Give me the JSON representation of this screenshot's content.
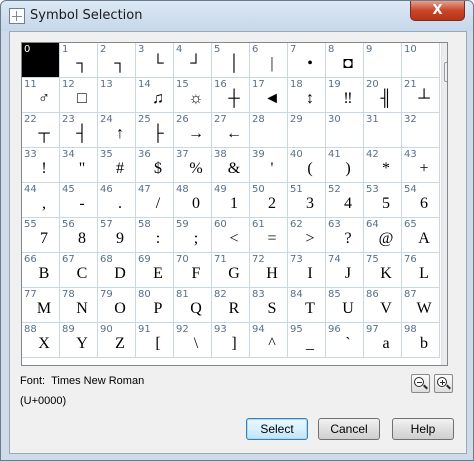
{
  "window": {
    "title": "Symbol Selection",
    "close_label": "X"
  },
  "grid": {
    "selected_index": 0,
    "cells": [
      {
        "num": "0",
        "glyph": ""
      },
      {
        "num": "1",
        "glyph": "┐"
      },
      {
        "num": "2",
        "glyph": "┐"
      },
      {
        "num": "3",
        "glyph": "└"
      },
      {
        "num": "4",
        "glyph": "┘"
      },
      {
        "num": "5",
        "glyph": "│"
      },
      {
        "num": "6",
        "glyph": "|"
      },
      {
        "num": "7",
        "glyph": "•"
      },
      {
        "num": "8",
        "glyph": "◘"
      },
      {
        "num": "9",
        "glyph": ""
      },
      {
        "num": "10",
        "glyph": ""
      },
      {
        "num": "11",
        "glyph": "♂"
      },
      {
        "num": "12",
        "glyph": "□"
      },
      {
        "num": "13",
        "glyph": ""
      },
      {
        "num": "14",
        "glyph": "♫"
      },
      {
        "num": "15",
        "glyph": "☼"
      },
      {
        "num": "16",
        "glyph": "┼"
      },
      {
        "num": "17",
        "glyph": "◄"
      },
      {
        "num": "18",
        "glyph": "↕"
      },
      {
        "num": "19",
        "glyph": "‼"
      },
      {
        "num": "20",
        "glyph": "╢"
      },
      {
        "num": "21",
        "glyph": "┴"
      },
      {
        "num": "22",
        "glyph": "┬"
      },
      {
        "num": "23",
        "glyph": "┤"
      },
      {
        "num": "24",
        "glyph": "↑"
      },
      {
        "num": "25",
        "glyph": "├"
      },
      {
        "num": "26",
        "glyph": "→"
      },
      {
        "num": "27",
        "glyph": "←"
      },
      {
        "num": "28",
        "glyph": ""
      },
      {
        "num": "29",
        "glyph": ""
      },
      {
        "num": "30",
        "glyph": ""
      },
      {
        "num": "31",
        "glyph": ""
      },
      {
        "num": "32",
        "glyph": ""
      },
      {
        "num": "33",
        "glyph": "!"
      },
      {
        "num": "34",
        "glyph": "\""
      },
      {
        "num": "35",
        "glyph": "#"
      },
      {
        "num": "36",
        "glyph": "$"
      },
      {
        "num": "37",
        "glyph": "%"
      },
      {
        "num": "38",
        "glyph": "&"
      },
      {
        "num": "39",
        "glyph": "'"
      },
      {
        "num": "40",
        "glyph": "("
      },
      {
        "num": "41",
        "glyph": ")"
      },
      {
        "num": "42",
        "glyph": "*"
      },
      {
        "num": "43",
        "glyph": "+"
      },
      {
        "num": "44",
        "glyph": ","
      },
      {
        "num": "45",
        "glyph": "-"
      },
      {
        "num": "46",
        "glyph": "."
      },
      {
        "num": "47",
        "glyph": "/"
      },
      {
        "num": "48",
        "glyph": "0"
      },
      {
        "num": "49",
        "glyph": "1"
      },
      {
        "num": "50",
        "glyph": "2"
      },
      {
        "num": "51",
        "glyph": "3"
      },
      {
        "num": "52",
        "glyph": "4"
      },
      {
        "num": "53",
        "glyph": "5"
      },
      {
        "num": "54",
        "glyph": "6"
      },
      {
        "num": "55",
        "glyph": "7"
      },
      {
        "num": "56",
        "glyph": "8"
      },
      {
        "num": "57",
        "glyph": "9"
      },
      {
        "num": "58",
        "glyph": ":"
      },
      {
        "num": "59",
        "glyph": ";"
      },
      {
        "num": "60",
        "glyph": "<"
      },
      {
        "num": "61",
        "glyph": "="
      },
      {
        "num": "62",
        "glyph": ">"
      },
      {
        "num": "63",
        "glyph": "?"
      },
      {
        "num": "64",
        "glyph": "@"
      },
      {
        "num": "65",
        "glyph": "A"
      },
      {
        "num": "66",
        "glyph": "B"
      },
      {
        "num": "67",
        "glyph": "C"
      },
      {
        "num": "68",
        "glyph": "D"
      },
      {
        "num": "69",
        "glyph": "E"
      },
      {
        "num": "70",
        "glyph": "F"
      },
      {
        "num": "71",
        "glyph": "G"
      },
      {
        "num": "72",
        "glyph": "H"
      },
      {
        "num": "73",
        "glyph": "I"
      },
      {
        "num": "74",
        "glyph": "J"
      },
      {
        "num": "75",
        "glyph": "K"
      },
      {
        "num": "76",
        "glyph": "L"
      },
      {
        "num": "77",
        "glyph": "M"
      },
      {
        "num": "78",
        "glyph": "N"
      },
      {
        "num": "79",
        "glyph": "O"
      },
      {
        "num": "80",
        "glyph": "P"
      },
      {
        "num": "81",
        "glyph": "Q"
      },
      {
        "num": "82",
        "glyph": "R"
      },
      {
        "num": "83",
        "glyph": "S"
      },
      {
        "num": "84",
        "glyph": "T"
      },
      {
        "num": "85",
        "glyph": "U"
      },
      {
        "num": "86",
        "glyph": "V"
      },
      {
        "num": "87",
        "glyph": "W"
      },
      {
        "num": "88",
        "glyph": "X"
      },
      {
        "num": "89",
        "glyph": "Y"
      },
      {
        "num": "90",
        "glyph": "Z"
      },
      {
        "num": "91",
        "glyph": "["
      },
      {
        "num": "92",
        "glyph": "\\"
      },
      {
        "num": "93",
        "glyph": "]"
      },
      {
        "num": "94",
        "glyph": "^"
      },
      {
        "num": "95",
        "glyph": "_"
      },
      {
        "num": "96",
        "glyph": "`"
      },
      {
        "num": "97",
        "glyph": "a"
      },
      {
        "num": "98",
        "glyph": "b"
      }
    ]
  },
  "scroll": {
    "up_icon": "▲",
    "down_icon": "▼"
  },
  "font_info": {
    "label": "Font:",
    "value": "Times New Roman"
  },
  "code_info": {
    "value": "(U+0000)"
  },
  "zoom": {
    "out_icon": "zoom-out-icon",
    "in_icon": "zoom-in-icon"
  },
  "buttons": {
    "select": "Select",
    "cancel": "Cancel",
    "help": "Help"
  },
  "colors": {
    "title_bar": "#c6d7ea",
    "close": "#c9452a",
    "selection": "#000000",
    "grid_line": "#c9d8e4",
    "default_button": "#3c7fb1"
  }
}
